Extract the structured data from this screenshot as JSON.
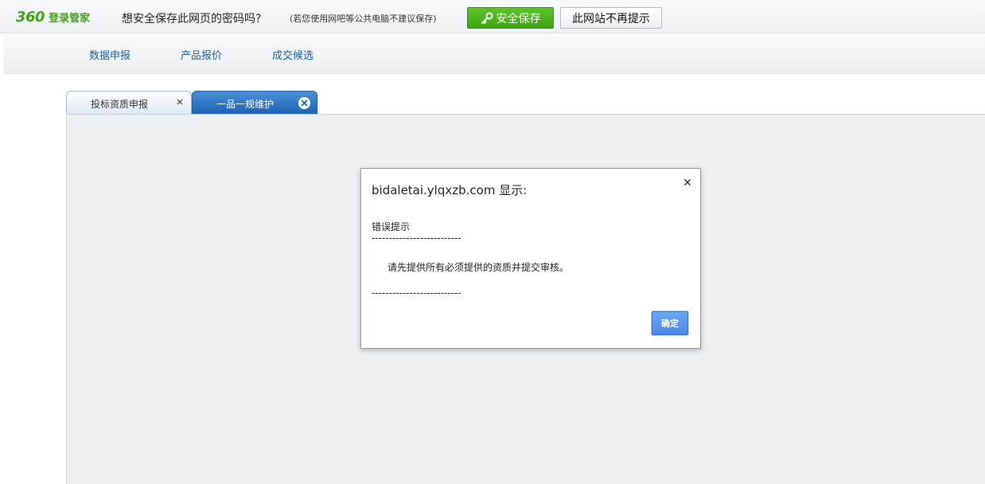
{
  "password_bar": {
    "logo_number": "360",
    "logo_text": "登录管家",
    "question": "想安全保存此网页的密码吗?",
    "hint": "(若您使用网吧等公共电脑不建议保存)",
    "save_label": "安全保存",
    "never_label": "此网站不再提示",
    "accent_color": "#43a515"
  },
  "menu": {
    "items": [
      {
        "label": "数据申报"
      },
      {
        "label": "产品报价"
      },
      {
        "label": "成交候选"
      }
    ]
  },
  "tabs": [
    {
      "label": "投标资质申报",
      "active": false
    },
    {
      "label": "一品一规维护",
      "active": true
    }
  ],
  "dialog": {
    "title": "bidaletai.ylqxzb.com 显示:",
    "message_head": "错误提示",
    "separator": "--------------------------",
    "message_body": "请先提供所有必须提供的资质并提交审核。",
    "ok_label": "确定"
  }
}
